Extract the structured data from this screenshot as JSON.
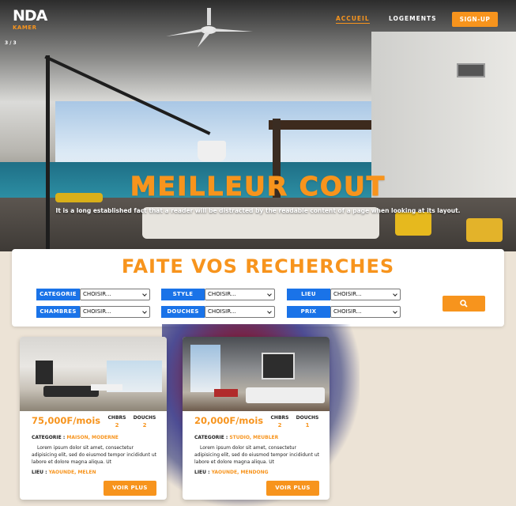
{
  "brand": {
    "logo_main": "NDA",
    "logo_sub": "KAMER",
    "accent": "#f7941d",
    "blue": "#1a73e8"
  },
  "slider": {
    "counter": "3 / 3"
  },
  "nav": {
    "items": [
      {
        "label": "ACCUEIL",
        "active": true
      },
      {
        "label": "LOGEMENTS",
        "active": false
      }
    ],
    "signup_label": "SIGN-UP"
  },
  "hero": {
    "title": "MEILLEUR COUT",
    "subtitle": "It is a long established fact that a reader will be distracted by the readable content of a page when looking at its layout."
  },
  "search": {
    "title": "FAITE VOS RECHERCHES",
    "fields": [
      {
        "label": "CATEGORIE",
        "value": "CHOISIR..."
      },
      {
        "label": "STYLE",
        "value": "CHOISIR..."
      },
      {
        "label": "LIEU",
        "value": "CHOISIR..."
      },
      {
        "label": "CHAMBRES",
        "value": "CHOISIR..."
      },
      {
        "label": "DOUCHES",
        "value": "CHOISIR..."
      },
      {
        "label": "PRIX",
        "value": "CHOISIR..."
      }
    ],
    "button_icon": "search-icon"
  },
  "listings": [
    {
      "price": "75,000F/mois",
      "chambres_label": "CHBRS",
      "chambres": "2",
      "douches_label": "DOUCHS",
      "douches": "2",
      "categorie_label": "CATEGORIE :",
      "categorie": "MAISON, MODERNE",
      "description": "Lorem ipsum dolor sit amet, consectetur adipisicing elit, sed do eiusmod tempor incididunt ut labore et dolore magna aliqua. Ut",
      "lieu_label": "LIEU :",
      "lieu": "YAOUNDE, MELEN",
      "button": "VOIR PLUS"
    },
    {
      "price": "20,000F/mois",
      "chambres_label": "CHBRS",
      "chambres": "2",
      "douches_label": "DOUCHS",
      "douches": "1",
      "categorie_label": "CATEGORIE :",
      "categorie": "STUDIO, MEUBLER",
      "description": "Lorem ipsum dolor sit amet, consectetur adipisicing elit, sed do eiusmod tempor incididunt ut labore et dolore magna aliqua. Ut",
      "lieu_label": "LIEU :",
      "lieu": "YAOUNDE, MENDONG",
      "button": "VOIR PLUS"
    }
  ]
}
